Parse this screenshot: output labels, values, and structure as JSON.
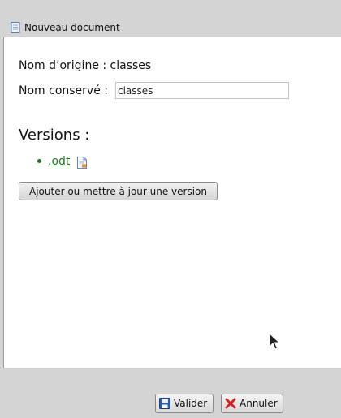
{
  "dialog": {
    "title": "Nouveau document",
    "title_icon": "document-icon"
  },
  "form": {
    "original_name_label": "Nom d’origine : classes",
    "kept_name_label": "Nom conservé :",
    "kept_name_value": "classes"
  },
  "versions": {
    "heading": "Versions :",
    "items": [
      {
        "label": ".odt",
        "icon": "odt-file-icon"
      }
    ],
    "update_button_label": "Ajouter ou mettre à jour une version"
  },
  "footer": {
    "validate_label": "Valider",
    "validate_icon": "save-icon",
    "cancel_label": "Annuler",
    "cancel_icon": "cancel-x-icon"
  },
  "colors": {
    "link_green": "#1f7a1f",
    "cancel_red": "#d62020",
    "save_blue": "#2a5db0"
  }
}
